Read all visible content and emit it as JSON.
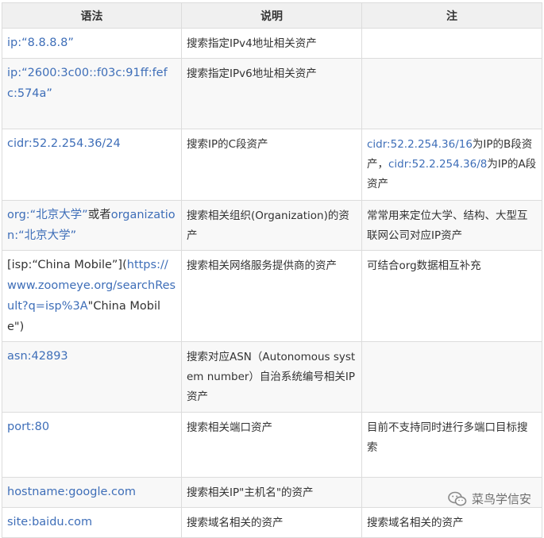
{
  "header": {
    "col1": "语法",
    "col2": "说明",
    "col3": "注"
  },
  "rows": [
    {
      "syntax": [
        {
          "text": "ip:“8.8.8.8”",
          "link": true
        }
      ],
      "desc": "搜索指定IPv4地址相关资产",
      "note": []
    },
    {
      "syntax": [
        {
          "text": "ip:“2600:3c00::f03c:91ff:fefc:574a”",
          "link": true
        }
      ],
      "desc": "搜索指定IPv6地址相关资产",
      "note": []
    },
    {
      "syntax": [
        {
          "text": "cidr:52.2.254.36/24",
          "link": true
        }
      ],
      "desc": "搜索IP的C段资产",
      "note": [
        {
          "text": "cidr:52.2.254.36/16",
          "link": true
        },
        {
          "text": "为IP的B段资产，",
          "link": false
        },
        {
          "text": "cidr:52.2.254.36/8",
          "link": true
        },
        {
          "text": "为IP的A段资产",
          "link": false
        }
      ]
    },
    {
      "syntax": [
        {
          "text": "org:“北京大学”",
          "link": true
        },
        {
          "text": "或者",
          "link": false
        },
        {
          "text": "organization:“北京大学”",
          "link": true
        }
      ],
      "desc": "搜索相关组织(Organization)的资产",
      "note": [
        {
          "text": "常常用来定位大学、结构、大型互联网公司对应IP资产",
          "link": false
        }
      ]
    },
    {
      "syntax": [
        {
          "text": "[isp:“China Mobile”]​(",
          "link": false
        },
        {
          "text": "https://www.zoomeye.org/searchResult?q=isp%3A",
          "link": true
        },
        {
          "text": "\"China Mobile\")",
          "link": false
        }
      ],
      "desc": "搜索相关网络服务提供商的资产",
      "note": [
        {
          "text": "可结合org数据相互补充",
          "link": false
        }
      ]
    },
    {
      "syntax": [
        {
          "text": "asn:42893",
          "link": true
        }
      ],
      "desc": "搜索对应ASN（Autonomous system number）自治系统编号相关IP资产",
      "note": []
    },
    {
      "syntax": [
        {
          "text": "port:80",
          "link": true
        }
      ],
      "desc": "搜索相关端口资产",
      "note": [
        {
          "text": "目前不支持同时进行多端口目标搜索",
          "link": false
        }
      ]
    },
    {
      "syntax": [
        {
          "text": "hostname:google.com",
          "link": true
        }
      ],
      "desc": "搜索相关IP\"主机名\"的资产",
      "note": []
    },
    {
      "syntax": [
        {
          "text": "site:baidu.com",
          "link": true
        }
      ],
      "desc": "搜索域名相关的资产",
      "note": [
        {
          "text": "搜索域名相关的资产",
          "link": false
        }
      ]
    }
  ],
  "watermark": {
    "text": "菜鸟学信安",
    "icon": "wechat-icon"
  },
  "colors": {
    "link": "#3e6eb8",
    "text": "#333333",
    "header_bg": "#f0f0f0",
    "stripe_bg": "#f8f8f8",
    "border": "#dcdcdc"
  }
}
